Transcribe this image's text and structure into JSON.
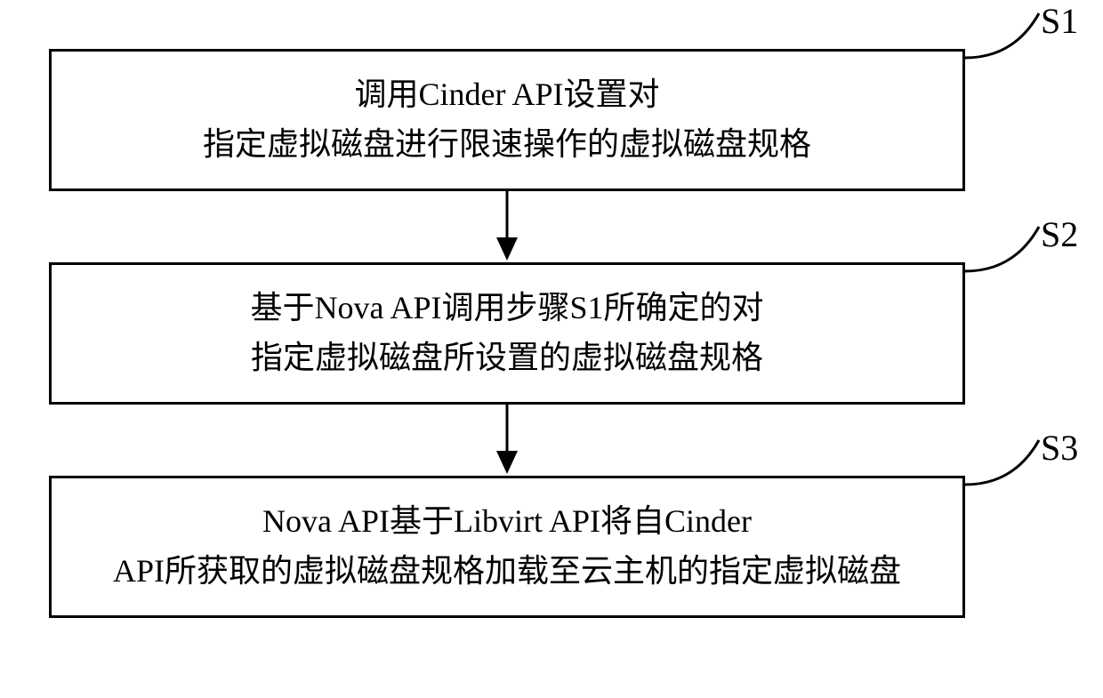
{
  "diagram": {
    "steps": [
      {
        "id": "S1",
        "label": "S1",
        "line1": "调用Cinder API设置对",
        "line2": "指定虚拟磁盘进行限速操作的虚拟磁盘规格"
      },
      {
        "id": "S2",
        "label": "S2",
        "line1": "基于Nova API调用步骤S1所确定的对",
        "line2": "指定虚拟磁盘所设置的虚拟磁盘规格"
      },
      {
        "id": "S3",
        "label": "S3",
        "line1": "Nova API基于Libvirt API将自Cinder",
        "line2": "API所获取的虚拟磁盘规格加载至云主机的指定虚拟磁盘"
      }
    ]
  }
}
